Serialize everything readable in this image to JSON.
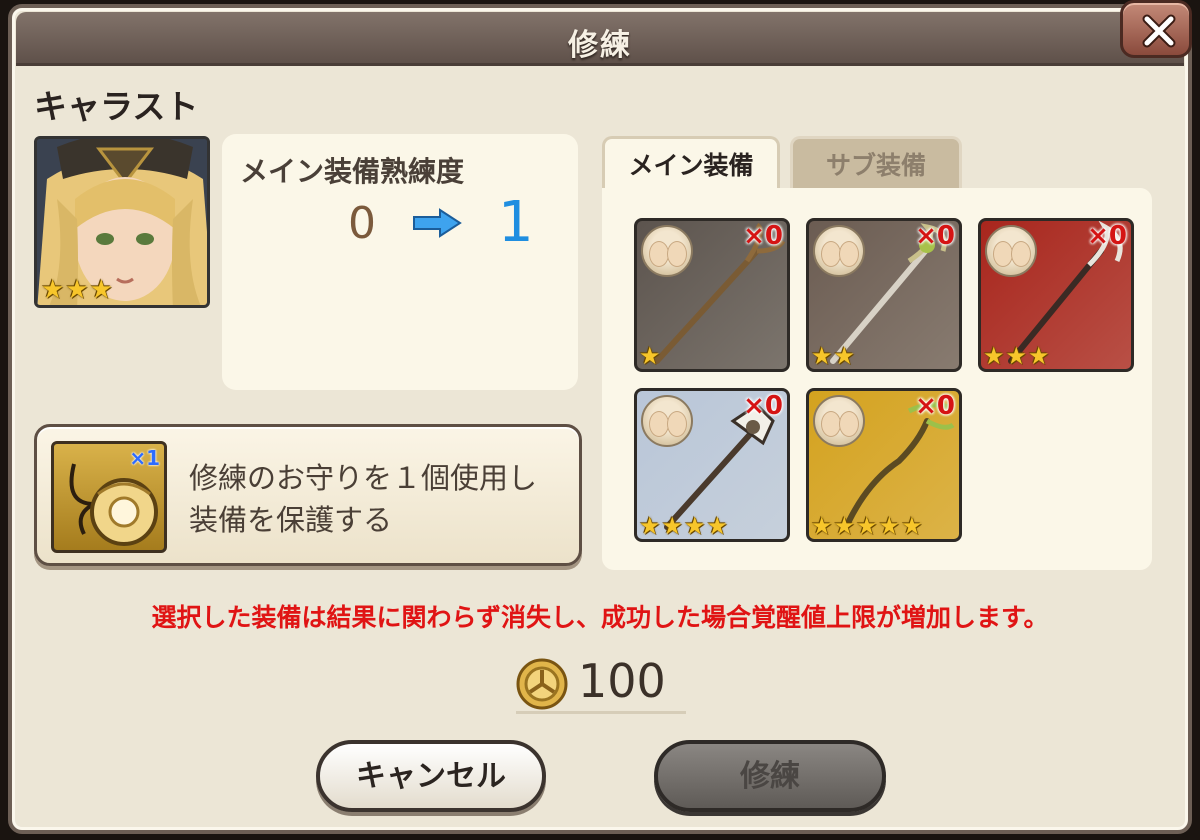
{
  "dialog": {
    "title": "修練",
    "close_icon": "close-icon"
  },
  "character": {
    "name": "キャラスト",
    "rarity_stars": 3
  },
  "mastery": {
    "label": "メイン装備熟練度",
    "from": "0",
    "to": "1"
  },
  "charm": {
    "count": "×1",
    "text_line1": "修練のお守りを１個使用し",
    "text_line2": "装備を保護する"
  },
  "tabs": [
    {
      "label": "メイン装備",
      "selected": true
    },
    {
      "label": "サブ装備",
      "selected": false
    }
  ],
  "items": [
    {
      "qty": "×0",
      "stars": 1,
      "bg": "#5c544e"
    },
    {
      "qty": "×0",
      "stars": 2,
      "bg": "#6b5c52"
    },
    {
      "qty": "×0",
      "stars": 3,
      "bg": "#a8261d"
    },
    {
      "qty": "×0",
      "stars": 4,
      "bg": "#b9c6d8"
    },
    {
      "qty": "×0",
      "stars": 5,
      "bg": "#d4a21f"
    }
  ],
  "warning": "選択した装備は結果に関わらず消失し、成功した場合覚醒値上限が増加します。",
  "cost": {
    "amount": "100",
    "icon": "coin-icon"
  },
  "buttons": {
    "cancel": "キャンセル",
    "train": "修練"
  },
  "colors": {
    "warning": "#e01414",
    "mastery_to": "#1f8ee0",
    "quantity": "#d51414",
    "star": "#f7c62b"
  }
}
